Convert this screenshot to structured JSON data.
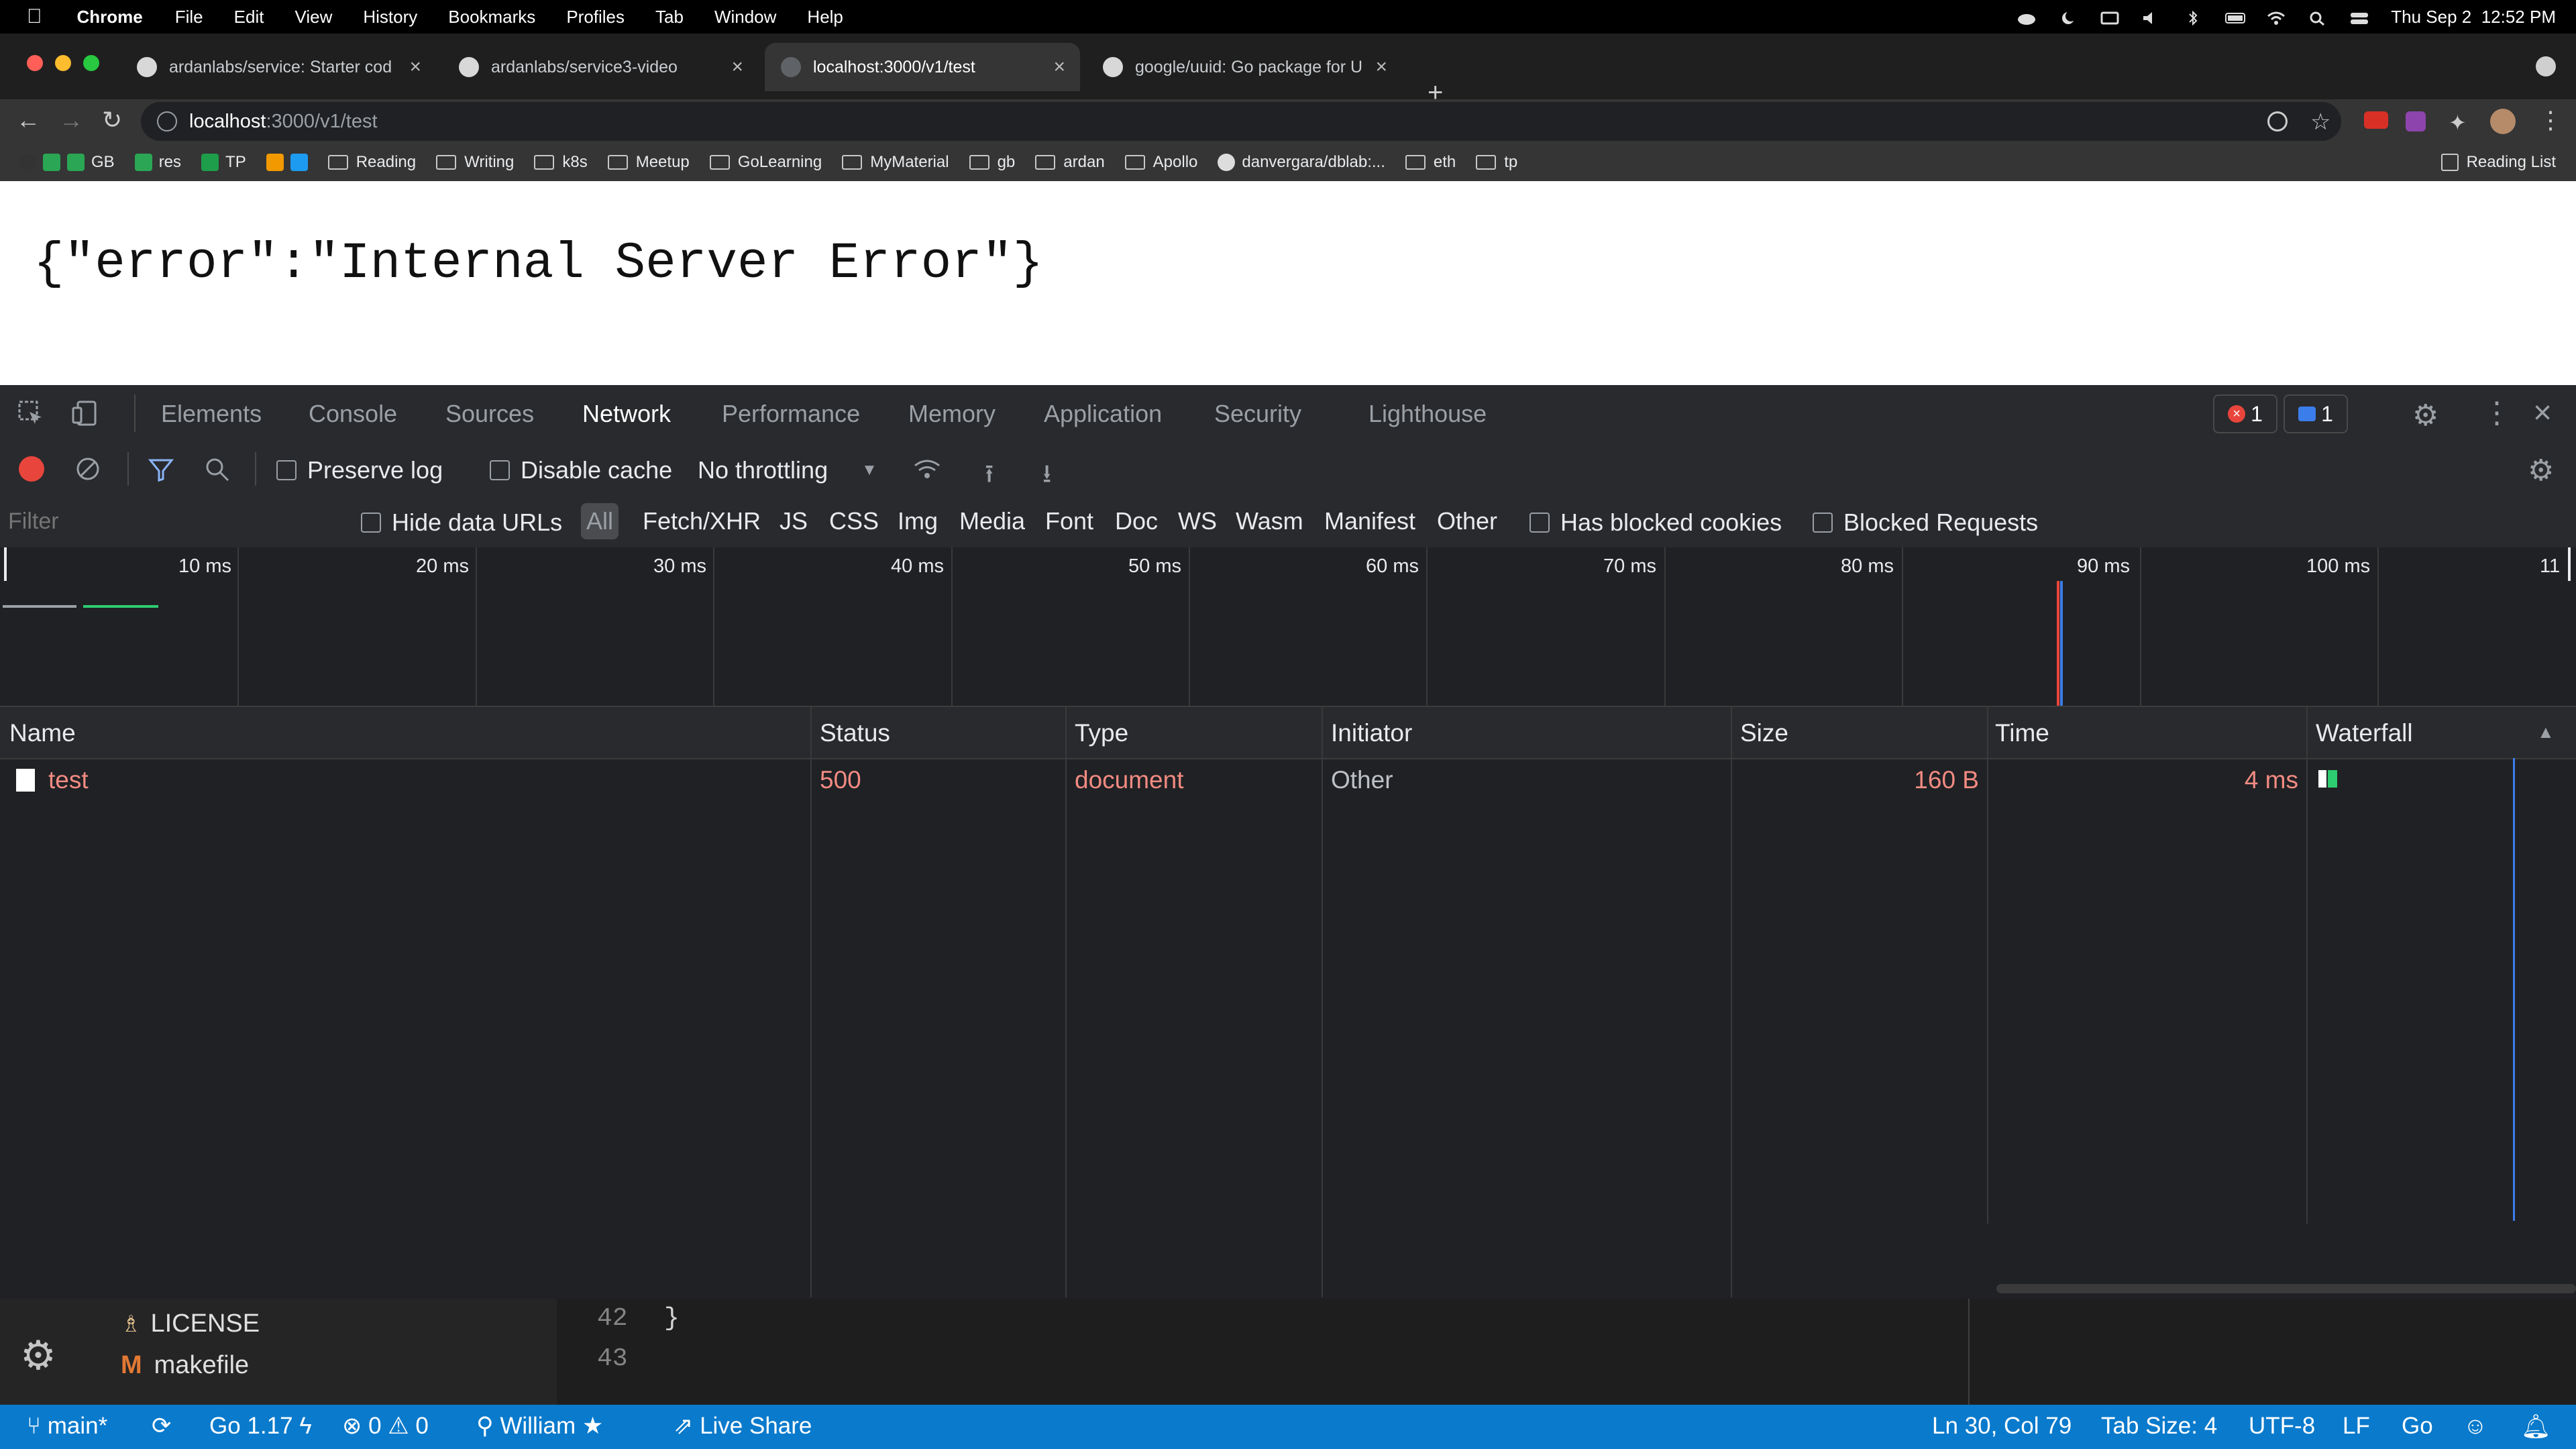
{
  "menubar": {
    "app_name": "Chrome",
    "items": [
      "File",
      "Edit",
      "View",
      "History",
      "Bookmarks",
      "Profiles",
      "Tab",
      "Window",
      "Help"
    ],
    "datetime": "Thu Sep 2  12:52 PM"
  },
  "tabs": [
    {
      "label": "ardanlabs/service: Starter cod",
      "active": false
    },
    {
      "label": "ardanlabs/service3-video",
      "active": false
    },
    {
      "label": "localhost:3000/v1/test",
      "active": true
    },
    {
      "label": "google/uuid: Go package for U",
      "active": false
    }
  ],
  "toolbar": {
    "url_host": "localhost",
    "url_path": ":3000/v1/test"
  },
  "bookmarks": {
    "items": [
      "GB",
      "res",
      "TP",
      "Reading",
      "Writing",
      "k8s",
      "Meetup",
      "GoLearning",
      "MyMaterial",
      "gb",
      "ardan",
      "Apollo",
      "danvergara/dblab:...",
      "eth",
      "tp"
    ],
    "reading_list": "Reading List"
  },
  "page": {
    "body_text": "{\"error\":\"Internal Server Error\"}"
  },
  "devtools": {
    "tabs": [
      "Elements",
      "Console",
      "Sources",
      "Network",
      "Performance",
      "Memory",
      "Application",
      "Security",
      "Lighthouse"
    ],
    "active_tab": "Network",
    "error_count": "1",
    "message_count": "1",
    "toolbar": {
      "preserve_log": "Preserve log",
      "disable_cache": "Disable cache",
      "throttling": "No throttling"
    },
    "filter_bar": {
      "placeholder": "Filter",
      "hide_data_urls": "Hide data URLs",
      "types": [
        "All",
        "Fetch/XHR",
        "JS",
        "CSS",
        "Img",
        "Media",
        "Font",
        "Doc",
        "WS",
        "Wasm",
        "Manifest",
        "Other"
      ],
      "has_blocked_cookies": "Has blocked cookies",
      "blocked_requests": "Blocked Requests"
    },
    "timeline_ticks": [
      "10 ms",
      "20 ms",
      "30 ms",
      "40 ms",
      "50 ms",
      "60 ms",
      "70 ms",
      "80 ms",
      "90 ms",
      "100 ms",
      "11"
    ],
    "columns": [
      "Name",
      "Status",
      "Type",
      "Initiator",
      "Size",
      "Time",
      "Waterfall"
    ],
    "rows": [
      {
        "name": "test",
        "status": "500",
        "type": "document",
        "initiator": "Other",
        "size": "160 B",
        "time": "4 ms"
      }
    ]
  },
  "vscode": {
    "files": [
      "LICENSE",
      "makefile"
    ],
    "line_numbers": [
      "42",
      "43"
    ],
    "line_42_code": "}",
    "status": {
      "branch": "main*",
      "go_version": "Go 1.17",
      "errors": "0",
      "warnings": "0",
      "user": "William",
      "live_share": "Live Share",
      "cursor": "Ln 30, Col 79",
      "tab_size": "Tab Size: 4",
      "encoding": "UTF-8",
      "eol": "LF",
      "language": "Go"
    }
  },
  "colors": {
    "devtools_bg": "#202124",
    "error_red": "#f28b82",
    "statusbar_blue": "#0a7acc",
    "record_red": "#e8453c"
  }
}
